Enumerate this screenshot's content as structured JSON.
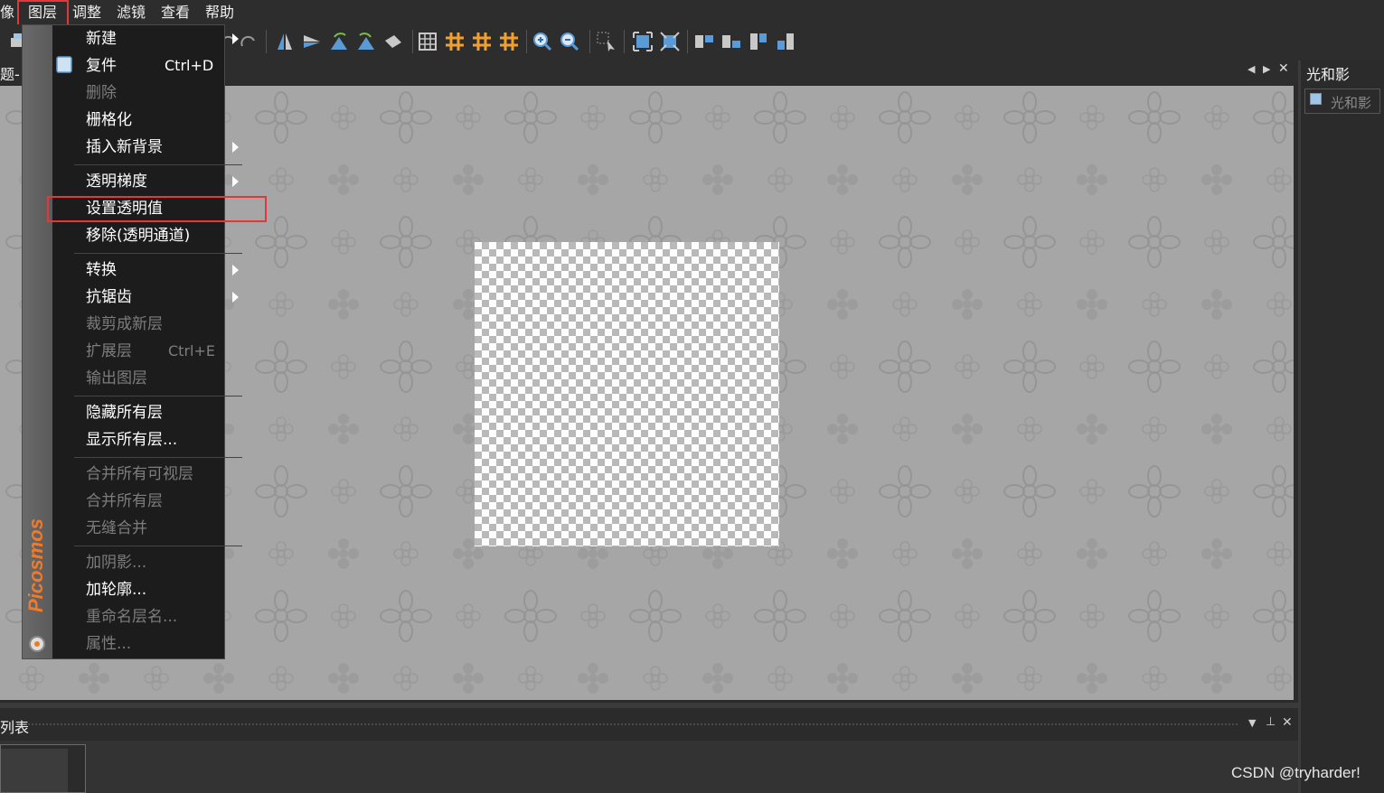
{
  "menubar": {
    "items": [
      "像",
      "图层",
      "调整",
      "滤镜",
      "查看",
      "帮助"
    ]
  },
  "document": {
    "tab_title": "题-"
  },
  "right_panel": {
    "title": "光和影",
    "item": "光和影"
  },
  "bottom_panel": {
    "title": "列表"
  },
  "layer_menu": {
    "brand": "Picosmos",
    "new": "新建",
    "duplicate": "复件",
    "duplicate_shortcut": "Ctrl+D",
    "delete": "删除",
    "rasterize": "栅格化",
    "insert_background": "插入新背景",
    "transparency_gradient": "透明梯度",
    "set_transparency": "设置透明值",
    "remove_alpha": "移除(透明通道)",
    "convert": "转换",
    "antialias": "抗锯齿",
    "crop_to_new_layer": "裁剪成新层",
    "expand_layer": "扩展层",
    "expand_shortcut": "Ctrl+E",
    "export_layer": "输出图层",
    "hide_all": "隐藏所有层",
    "show_all": "显示所有层...",
    "merge_visible": "合并所有可视层",
    "merge_all": "合并所有层",
    "seamless_merge": "无缝合并",
    "add_shadow": "加阴影...",
    "add_outline": "加轮廓...",
    "rename": "重命名层名...",
    "properties": "属性..."
  },
  "watermark": "CSDN @tryharder!",
  "colors": {
    "highlight": "#e0393b",
    "menu_bg": "#1c1c1c",
    "canvas_bg": "#a6a6a6",
    "toolbar_icon": "#5b9bd5",
    "toolbar_grid": "#f0a030"
  }
}
